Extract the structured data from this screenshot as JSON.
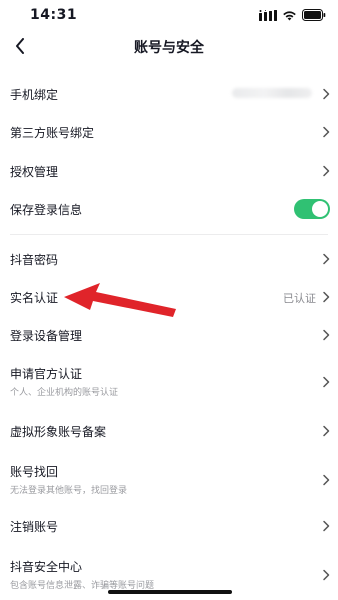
{
  "status_bar": {
    "time": "14:31"
  },
  "nav": {
    "title": "账号与安全",
    "back_icon": "chevron-left-icon"
  },
  "rows": {
    "phone": {
      "label": "手机绑定"
    },
    "third_party": {
      "label": "第三方账号绑定"
    },
    "auth_manage": {
      "label": "授权管理"
    },
    "save_login": {
      "label": "保存登录信息",
      "toggle_on": true
    },
    "douyin_password": {
      "label": "抖音密码"
    },
    "real_name": {
      "label": "实名认证",
      "value": "已认证"
    },
    "login_devices": {
      "label": "登录设备管理"
    },
    "official_cert": {
      "label": "申请官方认证",
      "sub": "个人、企业机构的账号认证"
    },
    "virtual_image": {
      "label": "虚拟形象账号备案"
    },
    "account_recovery": {
      "label": "账号找回",
      "sub": "无法登录其他账号，找回登录"
    },
    "cancel_account": {
      "label": "注销账号"
    },
    "security_center": {
      "label": "抖音安全中心",
      "sub": "包含账号信息泄露、诈骗等账号问题"
    }
  },
  "colors": {
    "toggle_on": "#30c173",
    "arrow": "#e0242a",
    "text": "#161823",
    "subtext": "#9a9ba0"
  }
}
